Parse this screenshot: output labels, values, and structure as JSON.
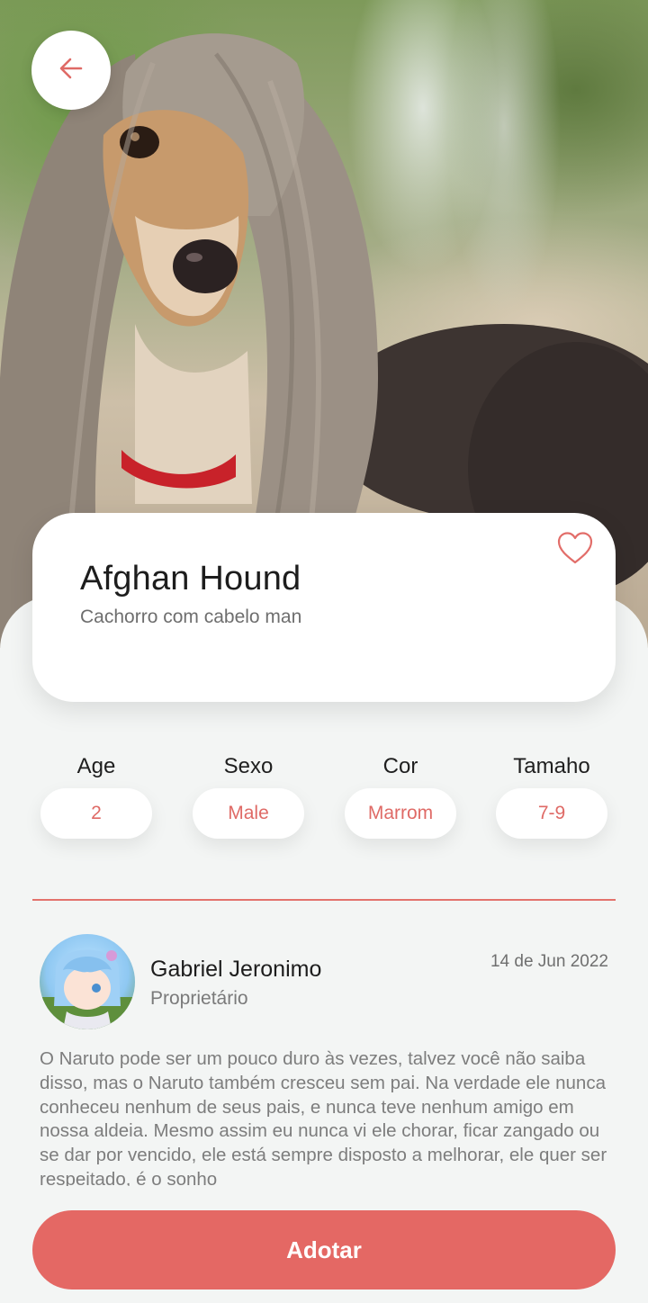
{
  "hero": {
    "photo_icon": "dog-photo"
  },
  "header": {
    "back_icon": "arrow-left-icon"
  },
  "pet": {
    "name": "Afghan Hound",
    "description": "Cachorro com cabelo man",
    "favorite_icon": "heart-outline-icon"
  },
  "attributes": [
    {
      "label": "Age",
      "value": "2"
    },
    {
      "label": "Sexo",
      "value": "Male"
    },
    {
      "label": "Cor",
      "value": "Marrom"
    },
    {
      "label": "Tamaho",
      "value": "7-9"
    }
  ],
  "owner": {
    "name": "Gabriel Jeronimo",
    "role": "Proprietário",
    "date": "14 de Jun 2022",
    "avatar_icon": "avatar"
  },
  "story": "O Naruto pode ser um pouco duro às vezes, talvez você não saiba disso, mas o Naruto também cresceu sem pai. Na verdade ele nunca conheceu nenhum de seus pais, e nunca teve nenhum amigo em nossa aldeia. Mesmo assim eu nunca vi ele chorar, ficar zangado ou se dar por vencido, ele está sempre disposto a melhorar, ele quer ser respeitado, é o sonho",
  "actions": {
    "adopt_label": "Adotar"
  },
  "colors": {
    "accent": "#e46864",
    "background": "#f3f5f4",
    "card": "#ffffff"
  }
}
